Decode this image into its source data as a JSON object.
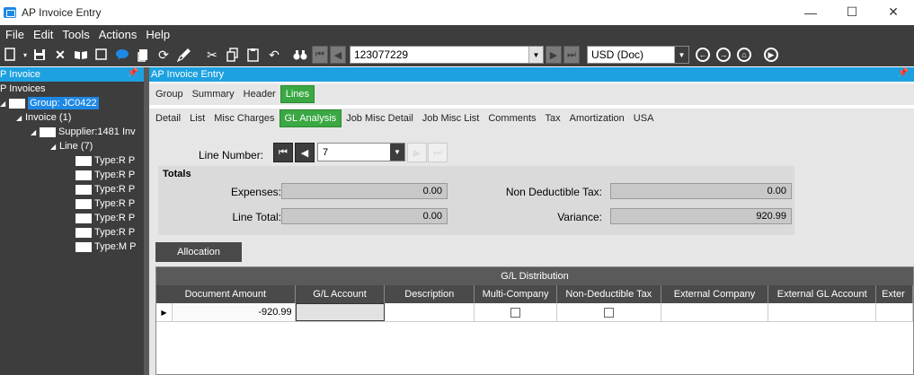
{
  "window": {
    "title": "AP Invoice Entry",
    "minimize": "—",
    "maximize": "☐",
    "close": "✕"
  },
  "menu": [
    "File",
    "Edit",
    "Tools",
    "Actions",
    "Help"
  ],
  "toolbar": {
    "invoice_search_value": "123077229",
    "currency_value": "USD (Doc)"
  },
  "tree_panel": {
    "header": "P Invoice",
    "root": "P Invoices",
    "group": "Group: JC0422",
    "invoice": "Invoice (1)",
    "supplier": "Supplier:1481 Inv",
    "line": "Line (7)",
    "types": [
      "Type:R P",
      "Type:R P",
      "Type:R P",
      "Type:R P",
      "Type:R P",
      "Type:R P",
      "Type:M P"
    ]
  },
  "main_panel": {
    "header": "AP Invoice Entry",
    "tabs_primary": [
      "Group",
      "Summary",
      "Header",
      "Lines"
    ],
    "active_primary": "Lines",
    "tabs_secondary": [
      "Detail",
      "List",
      "Misc Charges",
      "GL Analysis",
      "Job Misc Detail",
      "Job Misc List",
      "Comments",
      "Tax",
      "Amortization",
      "USA"
    ],
    "active_secondary": "GL Analysis",
    "line_number_label": "Line Number:",
    "line_number_value": "7",
    "totals": {
      "title": "Totals",
      "expenses_label": "Expenses:",
      "expenses_value": "0.00",
      "line_total_label": "Line Total:",
      "line_total_value": "0.00",
      "non_deductible_label": "Non Deductible Tax:",
      "non_deductible_value": "0.00",
      "variance_label": "Variance:",
      "variance_value": "920.99"
    },
    "allocation_button": "Allocation",
    "grid": {
      "title": "G/L Distribution",
      "columns": [
        "Document Amount",
        "G/L Account",
        "Description",
        "Multi-Company",
        "Non-Deductible Tax",
        "External Company",
        "External GL Account",
        "Exter"
      ],
      "rows": [
        {
          "document_amount": "-920.99",
          "gl_account": "",
          "description": "",
          "multi_company": false,
          "non_deductible_tax": false,
          "external_company": "",
          "external_gl_account": "",
          "exter": ""
        }
      ]
    }
  },
  "colors": {
    "accent_blue": "#1da1e0",
    "active_tab_green": "#3aa843",
    "dark_chrome": "#3d3d3d"
  }
}
